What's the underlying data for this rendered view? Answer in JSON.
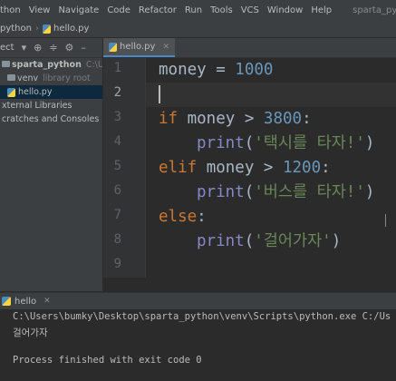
{
  "menu": {
    "items": [
      "thon",
      "View",
      "Navigate",
      "Code",
      "Refactor",
      "Run",
      "Tools",
      "VCS",
      "Window",
      "Help"
    ],
    "window_title": "sparta_python - hello.py"
  },
  "breadcrumb": {
    "project": "python",
    "file": "hello.py"
  },
  "project_toolbar": {
    "label": "ect"
  },
  "project_tree": {
    "root": "sparta_python",
    "root_path": "C:\\Users\\bu",
    "venv": "venv",
    "venv_note": "library root",
    "file": "hello.py",
    "external": "xternal Libraries",
    "scratches": "cratches and Consoles"
  },
  "editor": {
    "tab_label": "hello.py",
    "line_numbers": [
      "1",
      "2",
      "3",
      "4",
      "5",
      "6",
      "7",
      "8",
      "9"
    ],
    "code": {
      "l1_var": "money",
      "l1_op": " = ",
      "l1_num": "1000",
      "l3_kw": "if",
      "l3_rest": " money > ",
      "l3_num": "3800",
      "l3_colon": ":",
      "l4_func": "print",
      "l4_open": "(",
      "l4_str": "'택시를 타자!'",
      "l4_close": ")",
      "l5_kw": "elif",
      "l5_rest": " money > ",
      "l5_num": "1200",
      "l5_colon": ":",
      "l6_func": "print",
      "l6_open": "(",
      "l6_str": "'버스를 타자!'",
      "l6_close": ")",
      "l7_kw": "else",
      "l7_colon": ":",
      "l8_func": "print",
      "l8_open": "(",
      "l8_str": "'걸어가자'",
      "l8_close": ")"
    }
  },
  "run": {
    "tab_label": "hello",
    "command": "C:\\Users\\bumky\\Desktop\\sparta_python\\venv\\Scripts\\python.exe C:/Us",
    "output": "걸어가자",
    "exit_message": "Process finished with exit code 0"
  },
  "colors": {
    "keyword": "#cc7832",
    "number": "#6897bb",
    "string": "#6a8759",
    "text": "#a9b7c6",
    "builtin": "#8888c6",
    "background": "#2b2b2b"
  }
}
